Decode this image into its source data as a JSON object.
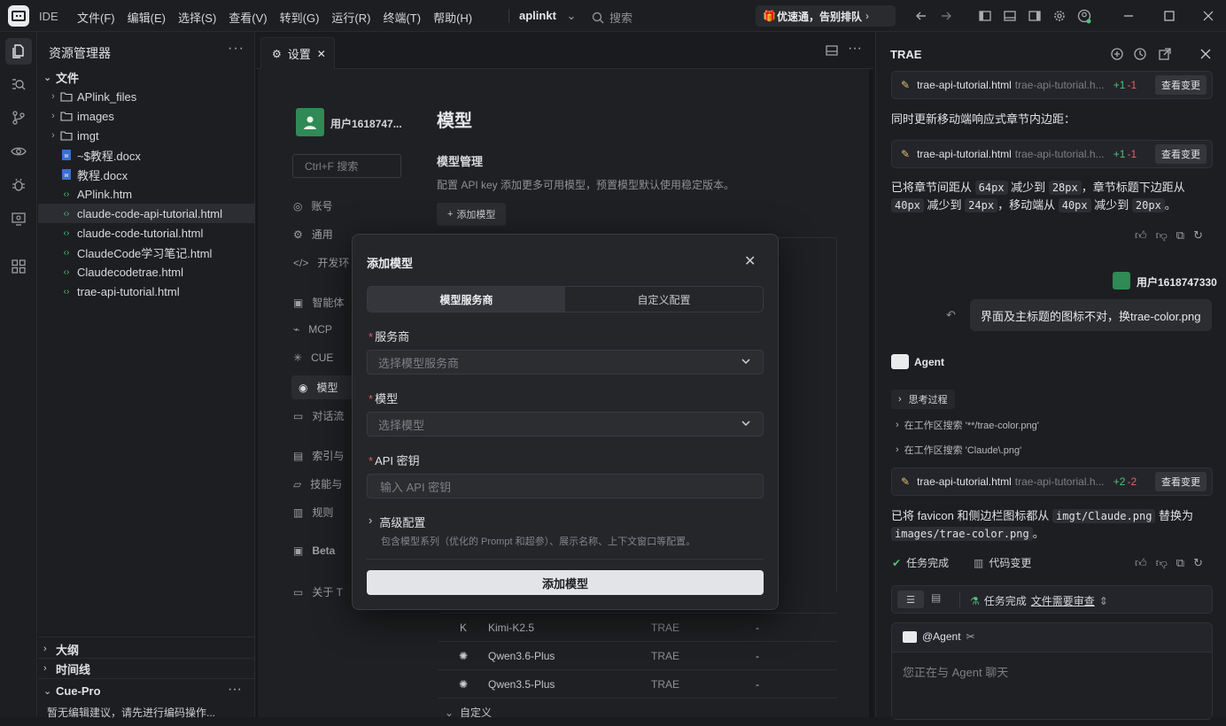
{
  "titlebar": {
    "app": "IDE",
    "menus": [
      "文件(F)",
      "编辑(E)",
      "选择(S)",
      "查看(V)",
      "转到(G)",
      "运行(R)",
      "终端(T)",
      "帮助(H)"
    ],
    "project": "aplinkt",
    "search_placeholder": "搜索",
    "promo": "优速通，告别排队"
  },
  "explorer": {
    "title": "资源管理器",
    "root": "文件",
    "items": [
      {
        "name": "APlink_files",
        "type": "folder"
      },
      {
        "name": "images",
        "type": "folder"
      },
      {
        "name": "imgt",
        "type": "folder"
      },
      {
        "name": "~$教程.docx",
        "type": "docx"
      },
      {
        "name": "教程.docx",
        "type": "docx"
      },
      {
        "name": "APlink.htm",
        "type": "html"
      },
      {
        "name": "claude-code-api-tutorial.html",
        "type": "html"
      },
      {
        "name": "claude-code-tutorial.html",
        "type": "html"
      },
      {
        "name": "ClaudeCode学习笔记.html",
        "type": "html"
      },
      {
        "name": "Claudecodetrae.html",
        "type": "html"
      },
      {
        "name": "trae-api-tutorial.html",
        "type": "html"
      }
    ],
    "outline": "大纲",
    "timeline": "时间线",
    "cue_pro": "Cue-Pro",
    "cue_hint": "暂无编辑建议，请先进行编码操作..."
  },
  "editor": {
    "tab": "设置",
    "user": "用户1618747...",
    "search_placeholder": "Ctrl+F 搜索",
    "nav": [
      "账号",
      "通用",
      "开发环",
      "智能体",
      "MCP",
      "CUE",
      "模型",
      "对话流",
      "索引与",
      "技能与",
      "规则",
      "Beta",
      "关于 T"
    ],
    "page_title": "模型",
    "section_title": "模型管理",
    "section_desc": "配置 API key 添加更多可用模型，预置模型默认使用稳定版本。",
    "add_button": "添加模型",
    "models": [
      {
        "name": "Kimi-K2.5",
        "provider": "TRAE",
        "extra": "-"
      },
      {
        "name": "Qwen3.6-Plus",
        "provider": "TRAE",
        "extra": "-"
      },
      {
        "name": "Qwen3.5-Plus",
        "provider": "TRAE",
        "extra": "-"
      }
    ],
    "custom_section": "自定义"
  },
  "modal": {
    "title": "添加模型",
    "tabs": [
      "模型服务商",
      "自定义配置"
    ],
    "provider_label": "服务商",
    "provider_placeholder": "选择模型服务商",
    "model_label": "模型",
    "model_placeholder": "选择模型",
    "key_label": "API 密钥",
    "key_placeholder": "输入 API 密钥",
    "advanced_label": "高级配置",
    "advanced_desc": "包含模型系列（优化的 Prompt 和超参）、展示名称、上下文窗口等配置。",
    "submit": "添加模型"
  },
  "chat": {
    "title": "TRAE",
    "cards": [
      {
        "file": "trae-api-tutorial.html",
        "path": "trae-api-tutorial.h...",
        "add": "+1",
        "del": "-1",
        "btn": "查看变更"
      },
      {
        "file": "trae-api-tutorial.html",
        "path": "trae-api-tutorial.h...",
        "add": "+1",
        "del": "-1",
        "btn": "查看变更"
      },
      {
        "file": "trae-api-tutorial.html",
        "path": "trae-api-tutorial.h...",
        "add": "+2",
        "del": "-2",
        "btn": "查看变更"
      }
    ],
    "msg1": "同时更新移动端响应式章节内边距：",
    "msg2_parts": [
      "已将章节间距从",
      "64px",
      "减少到",
      "28px",
      "，章节标题下边距从",
      "40px",
      "减少到",
      "24px",
      "，移动端从",
      "40px",
      "减少到",
      "20px",
      "。"
    ],
    "user_name": "用户1618747330",
    "user_msg": "界面及主标题的图标不对，换trae-color.png",
    "agent_name": "Agent",
    "think": "思考过程",
    "step1": "在工作区搜索 '**/trae-color.png'",
    "step2": "在工作区搜索 'Claude\\.png'",
    "msg3_parts": [
      "已将 favicon 和侧边栏图标都从",
      "imgt/Claude.png",
      "替换为",
      "images/trae-color.png",
      "。"
    ],
    "task_done": "任务完成",
    "code_change": "代码变更",
    "status_done": "任务完成",
    "status_review": "文件需要审查",
    "input_agent": "@Agent",
    "input_placeholder": "您正在与 Agent 聊天"
  },
  "colors": {
    "accent_green": "#4fc27a",
    "delete_red": "#e26161",
    "required": "#e35a5a"
  }
}
